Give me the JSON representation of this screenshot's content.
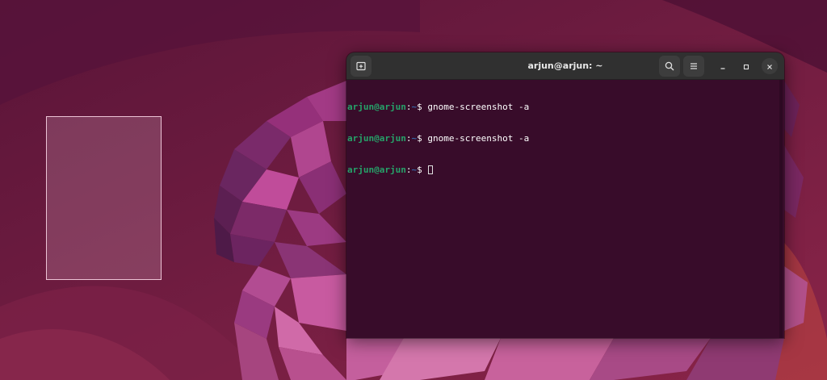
{
  "window": {
    "title": "arjun@arjun: ~"
  },
  "terminal": {
    "lines": [
      {
        "user": "arjun@arjun",
        "sep": ":",
        "path": "~",
        "symbol": "$",
        "command": "gnome-screenshot -a"
      },
      {
        "user": "arjun@arjun",
        "sep": ":",
        "path": "~",
        "symbol": "$",
        "command": "gnome-screenshot -a"
      },
      {
        "user": "arjun@arjun",
        "sep": ":",
        "path": "~",
        "symbol": "$",
        "command": ""
      }
    ]
  },
  "icons": {
    "new_tab": "new-tab-icon",
    "search": "search-icon",
    "menu": "hamburger-menu-icon",
    "minimize": "minimize-icon",
    "maximize": "maximize-icon",
    "close": "close-icon"
  },
  "colors": {
    "desktop_bg": "#6a1a3c",
    "terminal_bg": "#380c2a",
    "titlebar_bg": "#303030",
    "prompt_user": "#26a269",
    "prompt_path": "#3465a4"
  }
}
